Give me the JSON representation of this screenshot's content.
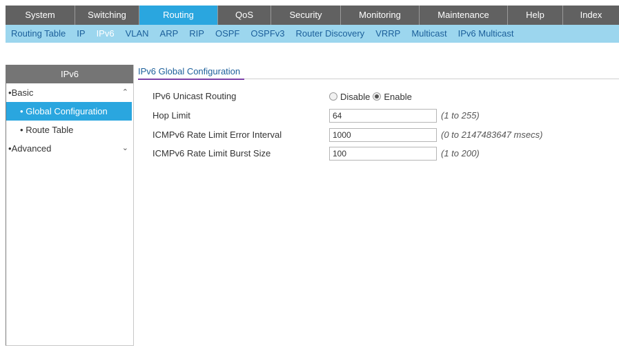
{
  "top_nav": {
    "active_color": "#2aa6df",
    "items": [
      {
        "label": "System"
      },
      {
        "label": "Switching"
      },
      {
        "label": "Routing"
      },
      {
        "label": "QoS"
      },
      {
        "label": "Security"
      },
      {
        "label": "Monitoring"
      },
      {
        "label": "Maintenance"
      },
      {
        "label": "Help"
      },
      {
        "label": "Index"
      }
    ],
    "active": "Routing"
  },
  "sub_nav": {
    "items": [
      {
        "label": "Routing Table"
      },
      {
        "label": "IP"
      },
      {
        "label": "IPv6"
      },
      {
        "label": "VLAN"
      },
      {
        "label": "ARP"
      },
      {
        "label": "RIP"
      },
      {
        "label": "OSPF"
      },
      {
        "label": "OSPFv3"
      },
      {
        "label": "Router Discovery"
      },
      {
        "label": "VRRP"
      },
      {
        "label": "Multicast"
      },
      {
        "label": "IPv6 Multicast"
      }
    ],
    "active": "IPv6"
  },
  "sidebar": {
    "title": "IPv6",
    "items": [
      {
        "label": "Basic",
        "bullet": "•",
        "chevron": "⌃"
      },
      {
        "label": "Global Configuration",
        "bullet": "•"
      },
      {
        "label": "Route Table",
        "bullet": "•"
      },
      {
        "label": "Advanced",
        "bullet": "•",
        "chevron": "⌄"
      }
    ]
  },
  "main": {
    "section_title": "IPv6 Global Configuration",
    "unicast_routing": {
      "label": "IPv6 Unicast Routing",
      "options": [
        {
          "label": "Disable",
          "checked": false
        },
        {
          "label": "Enable",
          "checked": true
        }
      ]
    },
    "hop_limit": {
      "label": "Hop Limit",
      "value": "64",
      "hint": "(1 to 255)"
    },
    "error_interval": {
      "label": "ICMPv6 Rate Limit Error Interval",
      "value": "1000",
      "hint": "(0 to 2147483647 msecs)"
    },
    "burst_size": {
      "label": "ICMPv6 Rate Limit Burst Size",
      "value": "100",
      "hint": "(1 to 200)"
    }
  }
}
